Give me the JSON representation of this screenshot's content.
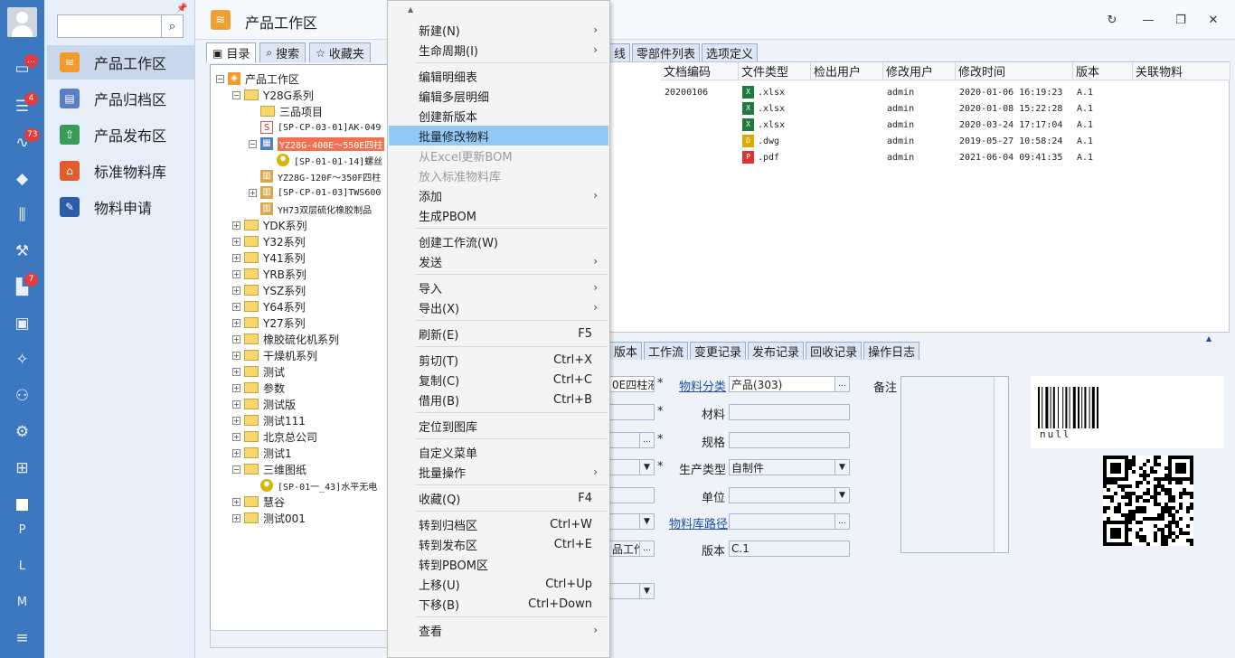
{
  "sidebar": {
    "badges": [
      "…",
      "4",
      "73",
      "7"
    ],
    "letters": [
      "P",
      "L",
      "M"
    ]
  },
  "nav": {
    "search_placeholder": "",
    "items": [
      {
        "label": "产品工作区",
        "color": "#f29a2e"
      },
      {
        "label": "产品归档区",
        "color": "#5a7ec6"
      },
      {
        "label": "产品发布区",
        "color": "#3a9d57"
      },
      {
        "label": "标准物料库",
        "color": "#e45c2c"
      },
      {
        "label": "物料申请",
        "color": "#2c5da8"
      }
    ]
  },
  "header": {
    "title": "产品工作区"
  },
  "tree_tabs": [
    "目录",
    "搜索",
    "收藏夹"
  ],
  "tree": [
    {
      "label": "产品工作区",
      "depth": 0,
      "exp": "−",
      "kind": "root"
    },
    {
      "label": "Y28G系列",
      "depth": 1,
      "exp": "−",
      "kind": "folder"
    },
    {
      "label": "三品项目",
      "depth": 2,
      "exp": "",
      "kind": "folder"
    },
    {
      "label": "[SP-CP-03-01]AK-049",
      "depth": 2,
      "exp": "",
      "kind": "doc"
    },
    {
      "label": "YZ28G-400E～550E四柱",
      "depth": 2,
      "exp": "−",
      "kind": "asm",
      "selected": true
    },
    {
      "label": "[SP-01-01-14]螺丝",
      "depth": 3,
      "exp": "",
      "kind": "part"
    },
    {
      "label": "YZ28G-120F～350F四柱",
      "depth": 2,
      "exp": "",
      "kind": "asm2"
    },
    {
      "label": "[SP-CP-01-03]TWS600",
      "depth": 2,
      "exp": "+",
      "kind": "asm2"
    },
    {
      "label": "YH73双层硫化橡胶制品",
      "depth": 2,
      "exp": "",
      "kind": "asm2"
    },
    {
      "label": "YDK系列",
      "depth": 1,
      "exp": "+",
      "kind": "folder"
    },
    {
      "label": "Y32系列",
      "depth": 1,
      "exp": "+",
      "kind": "folder"
    },
    {
      "label": "Y41系列",
      "depth": 1,
      "exp": "+",
      "kind": "folder"
    },
    {
      "label": "YRB系列",
      "depth": 1,
      "exp": "+",
      "kind": "folder"
    },
    {
      "label": "YSZ系列",
      "depth": 1,
      "exp": "+",
      "kind": "folder"
    },
    {
      "label": "Y64系列",
      "depth": 1,
      "exp": "+",
      "kind": "folder"
    },
    {
      "label": "Y27系列",
      "depth": 1,
      "exp": "+",
      "kind": "folder"
    },
    {
      "label": "橡胶硫化机系列",
      "depth": 1,
      "exp": "+",
      "kind": "folder"
    },
    {
      "label": "干燥机系列",
      "depth": 1,
      "exp": "+",
      "kind": "folder"
    },
    {
      "label": "测试",
      "depth": 1,
      "exp": "+",
      "kind": "folder"
    },
    {
      "label": "参数",
      "depth": 1,
      "exp": "+",
      "kind": "folder"
    },
    {
      "label": "测试版",
      "depth": 1,
      "exp": "+",
      "kind": "folder"
    },
    {
      "label": "测试111",
      "depth": 1,
      "exp": "+",
      "kind": "folder"
    },
    {
      "label": "北京总公司",
      "depth": 1,
      "exp": "+",
      "kind": "folder"
    },
    {
      "label": "测试1",
      "depth": 1,
      "exp": "+",
      "kind": "folder"
    },
    {
      "label": "三维图纸",
      "depth": 1,
      "exp": "−",
      "kind": "folder"
    },
    {
      "label": "[SP-01一_43]水平无电",
      "depth": 2,
      "exp": "",
      "kind": "part"
    },
    {
      "label": "慧谷",
      "depth": 1,
      "exp": "+",
      "kind": "folder"
    },
    {
      "label": "测试001",
      "depth": 1,
      "exp": "+",
      "kind": "folder"
    }
  ],
  "grid_tabs": [
    "线",
    "零部件列表",
    "选项定义"
  ],
  "grid_headers": [
    "文档编码",
    "文件类型",
    "检出用户",
    "修改用户",
    "修改时间",
    "版本",
    "关联物料"
  ],
  "grid_rows": [
    {
      "code": "20200106",
      "type": ".xlsx",
      "icon": "xlsx",
      "checkout": "",
      "user": "admin",
      "time": "2020-01-06 16:19:23",
      "ver": "A.1"
    },
    {
      "code": "",
      "type": ".xlsx",
      "icon": "xlsx",
      "checkout": "",
      "user": "admin",
      "time": "2020-01-08 15:22:28",
      "ver": "A.1"
    },
    {
      "code": "",
      "type": ".xlsx",
      "icon": "xlsx",
      "checkout": "",
      "user": "admin",
      "time": "2020-03-24 17:17:04",
      "ver": "A.1"
    },
    {
      "code": "",
      "type": ".dwg",
      "icon": "dwg",
      "checkout": "",
      "user": "admin",
      "time": "2019-05-27 10:58:24",
      "ver": "A.1"
    },
    {
      "code": "",
      "type": ".pdf",
      "icon": "pdf",
      "checkout": "",
      "user": "admin",
      "time": "2021-06-04 09:41:35",
      "ver": "A.1"
    }
  ],
  "detail_tabs": [
    "版本",
    "工作流",
    "变更记录",
    "发布记录",
    "回收记录",
    "操作日志"
  ],
  "detail": {
    "name_value": "0E四柱液",
    "category_label": "物料分类",
    "category_value": "产品(303)",
    "material_label": "材料",
    "spec_label": "规格",
    "prod_type_label": "生产类型",
    "prod_type_value": "自制件",
    "unit_label": "单位",
    "lib_path_label": "物料库路径",
    "location_value": "品工作",
    "version_label": "版本",
    "version_value": "C.1",
    "remark_label": "备注",
    "barcode_text": "null",
    "star": "*"
  },
  "menu": [
    {
      "label": "新建(N)",
      "shortcut": "",
      "arrow": true,
      "dis": false
    },
    {
      "label": "生命周期(I)",
      "shortcut": "",
      "arrow": true,
      "dis": false
    },
    {
      "label": "编辑明细表",
      "shortcut": "",
      "arrow": false,
      "dis": false
    },
    {
      "label": "编辑多层明细",
      "shortcut": "",
      "arrow": false,
      "dis": false
    },
    {
      "label": "创建新版本",
      "shortcut": "",
      "arrow": false,
      "dis": false
    },
    {
      "label": "批量修改物料",
      "shortcut": "",
      "arrow": false,
      "dis": false,
      "hl": true
    },
    {
      "label": "从Excel更新BOM",
      "shortcut": "",
      "arrow": false,
      "dis": true
    },
    {
      "label": "放入标准物料库",
      "shortcut": "",
      "arrow": false,
      "dis": true
    },
    {
      "label": "添加",
      "shortcut": "",
      "arrow": true,
      "dis": false
    },
    {
      "label": "生成PBOM",
      "shortcut": "",
      "arrow": false,
      "dis": false
    },
    {
      "label": "创建工作流(W)",
      "shortcut": "",
      "arrow": false,
      "dis": false
    },
    {
      "label": "发送",
      "shortcut": "",
      "arrow": true,
      "dis": false
    },
    {
      "label": "导入",
      "shortcut": "",
      "arrow": true,
      "dis": false
    },
    {
      "label": "导出(X)",
      "shortcut": "",
      "arrow": true,
      "dis": false
    },
    {
      "label": "刷新(E)",
      "shortcut": "F5",
      "arrow": false,
      "dis": false
    },
    {
      "label": "剪切(T)",
      "shortcut": "Ctrl+X",
      "arrow": false,
      "dis": false
    },
    {
      "label": "复制(C)",
      "shortcut": "Ctrl+C",
      "arrow": false,
      "dis": false
    },
    {
      "label": "借用(B)",
      "shortcut": "Ctrl+B",
      "arrow": false,
      "dis": false
    },
    {
      "label": "定位到图库",
      "shortcut": "",
      "arrow": false,
      "dis": false
    },
    {
      "label": "自定义菜单",
      "shortcut": "",
      "arrow": false,
      "dis": false
    },
    {
      "label": "批量操作",
      "shortcut": "",
      "arrow": true,
      "dis": false
    },
    {
      "label": "收藏(Q)",
      "shortcut": "F4",
      "arrow": false,
      "dis": false
    },
    {
      "label": "转到归档区",
      "shortcut": "Ctrl+W",
      "arrow": false,
      "dis": false
    },
    {
      "label": "转到发布区",
      "shortcut": "Ctrl+E",
      "arrow": false,
      "dis": false
    },
    {
      "label": "转到PBOM区",
      "shortcut": "",
      "arrow": false,
      "dis": false
    },
    {
      "label": "上移(U)",
      "shortcut": "Ctrl+Up",
      "arrow": false,
      "dis": false
    },
    {
      "label": "下移(B)",
      "shortcut": "Ctrl+Down",
      "arrow": false,
      "dis": false
    },
    {
      "label": "查看",
      "shortcut": "",
      "arrow": true,
      "dis": false
    }
  ]
}
